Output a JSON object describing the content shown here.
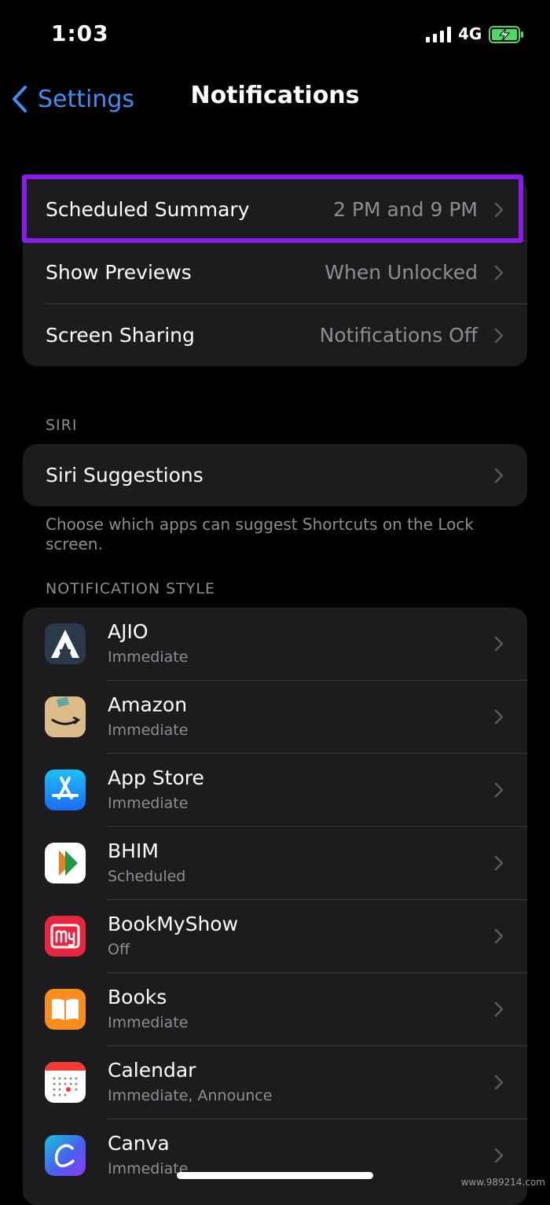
{
  "status_bar": {
    "time": "1:03",
    "network": "4G",
    "icons": [
      "cellular-signal-icon",
      "battery-charging-icon"
    ]
  },
  "nav": {
    "back_label": "Settings",
    "title": "Notifications",
    "back_icon": "chevron-left-icon"
  },
  "general": [
    {
      "label": "Scheduled Summary",
      "value": "2 PM and 9 PM",
      "highlighted": true
    },
    {
      "label": "Show Previews",
      "value": "When Unlocked"
    },
    {
      "label": "Screen Sharing",
      "value": "Notifications Off"
    }
  ],
  "siri": {
    "header": "SIRI",
    "item": "Siri Suggestions",
    "footer": "Choose which apps can suggest Shortcuts on the Lock screen."
  },
  "notification_style": {
    "header": "NOTIFICATION STYLE",
    "apps": [
      {
        "name": "AJIO",
        "status": "Immediate",
        "icon": "ajio-icon"
      },
      {
        "name": "Amazon",
        "status": "Immediate",
        "icon": "amazon-icon"
      },
      {
        "name": "App Store",
        "status": "Immediate",
        "icon": "app-store-icon"
      },
      {
        "name": "BHIM",
        "status": "Scheduled",
        "icon": "bhim-icon"
      },
      {
        "name": "BookMyShow",
        "status": "Off",
        "icon": "bookmyshow-icon"
      },
      {
        "name": "Books",
        "status": "Immediate",
        "icon": "books-icon"
      },
      {
        "name": "Calendar",
        "status": "Immediate, Announce",
        "icon": "calendar-icon"
      },
      {
        "name": "Canva",
        "status": "Immediate",
        "icon": "canva-icon"
      }
    ]
  },
  "watermark": "www.989214.com",
  "colors": {
    "background": "#000000",
    "card": "#1c1c1e",
    "accent": "#3d8ff0",
    "secondary_text": "#8d8d93",
    "highlight": "#8a1bea",
    "battery": "#4cd964"
  }
}
